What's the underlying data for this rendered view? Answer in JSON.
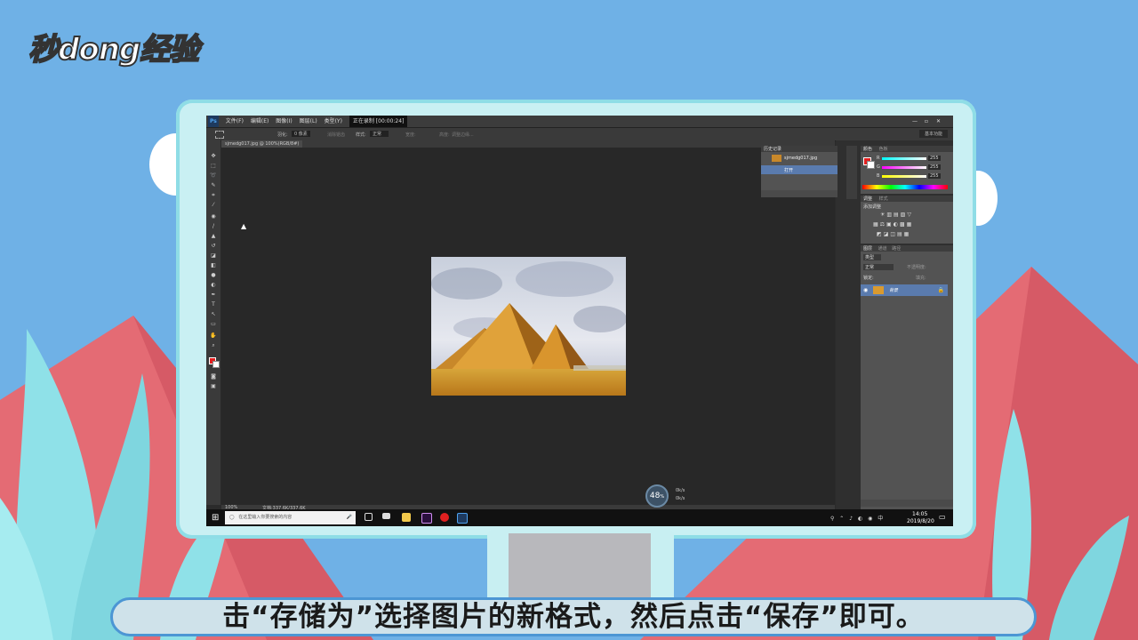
{
  "logo": {
    "text": "秒dong经验"
  },
  "subtitle": {
    "text": "击“存储为”选择图片的新格式，然后点击“保存”即可。"
  },
  "photoshop": {
    "app_icon": "Ps",
    "menus": [
      "文件(F)",
      "编辑(E)",
      "图像(I)",
      "图层(L)",
      "类型(Y)"
    ],
    "recording_label": "正在录制 [00:00:24]",
    "options": {
      "feather_label": "羽化:",
      "feather_value": "0 像素",
      "antialias_label": "消除锯齿",
      "style_label": "样式:",
      "style_value": "正常",
      "width_label": "宽度:",
      "height_label": "高度:",
      "refine_label": "调整边缘..."
    },
    "workspace_label": "基本功能",
    "document_tab": "sjmedg017.jpg @ 100%(RGB/8#)",
    "status": {
      "zoom": "100%",
      "doc_size": "文档:337.6K/337.6K"
    },
    "history_panel": {
      "tab": "历史记录",
      "snapshot": "sjmedg017.jpg",
      "step": "打开"
    },
    "color_panel": {
      "tabs": [
        "颜色",
        "色板"
      ],
      "r_label": "R",
      "g_label": "G",
      "b_label": "B",
      "r": "255",
      "g": "255",
      "b": "255"
    },
    "adjust_panel": {
      "tabs": [
        "调整",
        "样式"
      ],
      "title": "添加调整"
    },
    "layers_panel": {
      "tabs": [
        "图层",
        "通道",
        "路径"
      ],
      "kind_label": "类型",
      "blend_mode": "正常",
      "opacity_label": "不透明度:",
      "lock_label": "锁定:",
      "fill_label": "填充:",
      "layer_name": "背景"
    }
  },
  "taskbar": {
    "search_placeholder": "在这里输入你要搜索的内容",
    "time": "14:05",
    "date": "2019/8/20"
  },
  "speed_meter": {
    "value": "48",
    "unit": "%",
    "up": "0k/s",
    "down": "0k/s"
  },
  "colors": {
    "sky": "#6fb1e6",
    "monitor": "#c9f0f3",
    "subtitle_border": "#4c96d4",
    "ps_dark": "#2b2b2b",
    "highlight": "#5a7bae"
  }
}
